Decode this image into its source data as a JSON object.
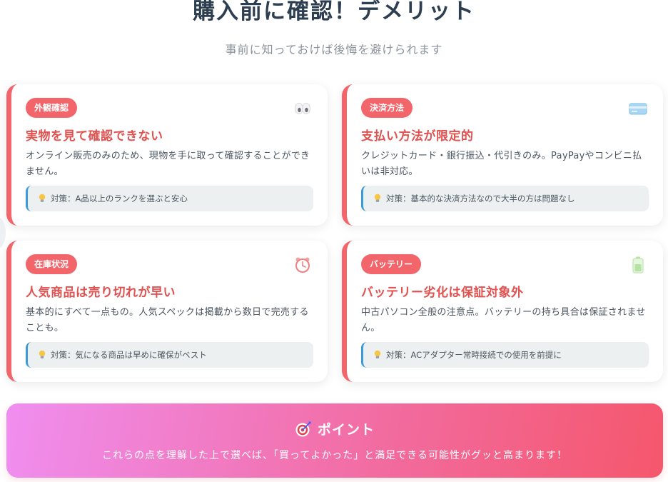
{
  "header": {
    "title": "購入前に確認！デメリット",
    "subtitle": "事前に知っておけば後悔を避けられます"
  },
  "cards": [
    {
      "tag": "外観確認",
      "icon": "eyes-icon",
      "title": "実物を見て確認できない",
      "description": "オンライン販売のみのため、現物を手に取って確認することができません。",
      "tip": "対策：A品以上のランクを選ぶと安心"
    },
    {
      "tag": "決済方法",
      "icon": "credit-card-icon",
      "title": "支払い方法が限定的",
      "description": "クレジットカード・銀行振込・代引きのみ。PayPayやコンビニ払いは非対応。",
      "tip": "対策：基本的な決済方法なので大半の方は問題なし"
    },
    {
      "tag": "在庫状況",
      "icon": "alarm-clock-icon",
      "title": "人気商品は売り切れが早い",
      "description": "基本的にすべて一点もの。人気スペックは掲載から数日で完売することも。",
      "tip": "対策：気になる商品は早めに確保がベスト"
    },
    {
      "tag": "バッテリー",
      "icon": "battery-icon",
      "title": "バッテリー劣化は保証対象外",
      "description": "中古パソコン全般の注意点。バッテリーの持ち具合は保証されません。",
      "tip": "対策：ACアダプター常時接続での使用を前提に"
    }
  ],
  "point": {
    "icon": "target-icon",
    "title": "ポイント",
    "text": "これらの点を理解した上で選べば、「買ってよかった」と満足できる可能性がグッと高まります！"
  },
  "colors": {
    "accent": "#f2656a",
    "title_red": "#e0514f",
    "tip_border": "#3b9bd9",
    "gradient_start": "#f08ef0",
    "gradient_end": "#f5576c"
  }
}
